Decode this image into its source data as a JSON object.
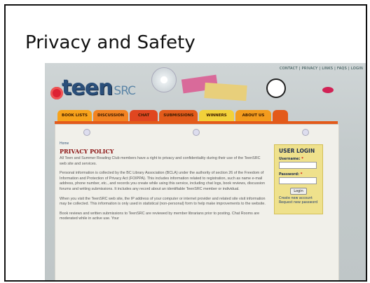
{
  "slide": {
    "title": "Privacy and Safety"
  },
  "site": {
    "logo_main": "teen",
    "logo_sub": "SRC",
    "top_nav": [
      "CONTACT",
      "PRIVACY",
      "LINKS",
      "FAQS",
      "LOGIN"
    ],
    "tabs": [
      {
        "label": "BOOK LISTS",
        "color": "#f7a21b"
      },
      {
        "label": "DISCUSSION",
        "color": "#f28322"
      },
      {
        "label": "CHAT",
        "color": "#e04620"
      },
      {
        "label": "SUBMISSIONS",
        "color": "#e25b1b"
      },
      {
        "label": "WINNERS",
        "color": "#f2d13a"
      },
      {
        "label": "ABOUT US",
        "color": "#f39b1d"
      }
    ],
    "accent": "#e35a1a"
  },
  "content": {
    "breadcrumb": "Home",
    "heading": "PRIVACY POLICY",
    "paragraphs": [
      "All Teen and Summer Reading Club members have a right to privacy and confidentiality during their use of the TeenSRC web site and services.",
      "Personal information is collected by the BC Library Association (BCLA) under the authority of section 26 of the Freedom of Information and Protection of Privacy Act (FOIPPA). This includes information related to registration, such as name e-mail address, phone number, etc., and records you create while using this service, including chat logs, book reviews, discussion forums and writing submissions. It includes any record about an identifiable TeenSRC member or individual.",
      "When you visit the TeenSRC web site, the IP address of your computer or internet provider and related site visit information may be collected. This information is only used in statistical (non-personal) form to help make improvements to the website.",
      "Book reviews and written submissions to TeenSRC are reviewed by member librarians prior to posting. Chat Rooms are moderated while in active use. Your"
    ]
  },
  "login": {
    "title": "USER LOGIN",
    "username_label": "Username:",
    "password_label": "Password:",
    "required_mark": "*",
    "button": "Login",
    "create_link": "Create new account",
    "request_link": "Request new password"
  }
}
